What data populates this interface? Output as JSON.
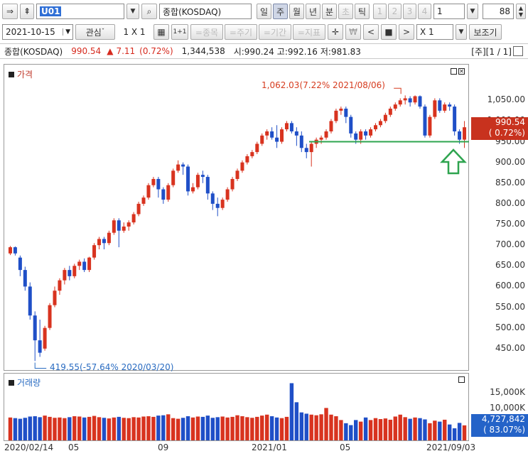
{
  "toolbar1": {
    "code": "U01",
    "index_name": "종합(KOSDAQ)",
    "periods": [
      "일",
      "주",
      "월",
      "년",
      "분",
      "초",
      "틱"
    ],
    "active_period": "주",
    "counts": [
      "1",
      "2",
      "3",
      "4"
    ],
    "count_value": "1",
    "zoom_value": "88"
  },
  "toolbar2": {
    "date": "2021-10-15",
    "watch_label": "관심",
    "layout_label": "1 X 1",
    "one_label": "1+1",
    "tabs": [
      "=종목",
      "=주기",
      "=기간",
      "=지표"
    ],
    "won_symbol": "₩",
    "multiplier": "X 1",
    "aux_label": "보조기"
  },
  "info": {
    "name": "종합(KOSDAQ)",
    "price": "990.54",
    "change_arrow": "▲",
    "change": "7.11",
    "change_pct": "(0.72%)",
    "volume": "1,344,538",
    "open": "시:990.24",
    "high": "고:992.16",
    "low": "저:981.83",
    "period_tag": "[주][1 / 1]"
  },
  "chart_data": [
    {
      "type": "candlestick",
      "title": "가격",
      "x_labels": [
        "2020/02/14",
        "05",
        "09",
        "2021/01",
        "05",
        "2021/09/03"
      ],
      "y_ticks": [
        450,
        500,
        550,
        600,
        650,
        700,
        750,
        800,
        850,
        900,
        950,
        1000,
        1050
      ],
      "ylim": [
        405,
        1090
      ],
      "annotations": {
        "high": "1,062.03(7.22% 2021/08/06)",
        "low": "419.55(-57.64% 2020/03/20)",
        "support_level": 950
      },
      "current_price": "990.54",
      "current_pct": "( 0.72%)",
      "candles": [
        {
          "o": 680,
          "c": 695,
          "h": 698,
          "l": 676
        },
        {
          "o": 695,
          "c": 680,
          "h": 697,
          "l": 675
        },
        {
          "o": 670,
          "c": 640,
          "h": 675,
          "l": 625
        },
        {
          "o": 640,
          "c": 600,
          "h": 648,
          "l": 590
        },
        {
          "o": 600,
          "c": 530,
          "h": 610,
          "l": 520
        },
        {
          "o": 530,
          "c": 470,
          "h": 540,
          "l": 420
        },
        {
          "o": 470,
          "c": 440,
          "h": 520,
          "l": 430
        },
        {
          "o": 450,
          "c": 500,
          "h": 505,
          "l": 445
        },
        {
          "o": 500,
          "c": 555,
          "h": 560,
          "l": 495
        },
        {
          "o": 555,
          "c": 590,
          "h": 600,
          "l": 550
        },
        {
          "o": 590,
          "c": 615,
          "h": 620,
          "l": 580
        },
        {
          "o": 615,
          "c": 640,
          "h": 645,
          "l": 605
        },
        {
          "o": 640,
          "c": 625,
          "h": 650,
          "l": 615
        },
        {
          "o": 625,
          "c": 650,
          "h": 655,
          "l": 620
        },
        {
          "o": 650,
          "c": 660,
          "h": 665,
          "l": 640
        },
        {
          "o": 660,
          "c": 640,
          "h": 668,
          "l": 635
        },
        {
          "o": 640,
          "c": 670,
          "h": 672,
          "l": 635
        },
        {
          "o": 670,
          "c": 700,
          "h": 705,
          "l": 665
        },
        {
          "o": 700,
          "c": 715,
          "h": 720,
          "l": 690
        },
        {
          "o": 715,
          "c": 705,
          "h": 720,
          "l": 690
        },
        {
          "o": 705,
          "c": 730,
          "h": 735,
          "l": 700
        },
        {
          "o": 730,
          "c": 760,
          "h": 765,
          "l": 725
        },
        {
          "o": 760,
          "c": 735,
          "h": 765,
          "l": 695
        },
        {
          "o": 735,
          "c": 745,
          "h": 755,
          "l": 730
        },
        {
          "o": 745,
          "c": 755,
          "h": 760,
          "l": 735
        },
        {
          "o": 755,
          "c": 775,
          "h": 780,
          "l": 750
        },
        {
          "o": 775,
          "c": 800,
          "h": 805,
          "l": 770
        },
        {
          "o": 800,
          "c": 815,
          "h": 820,
          "l": 795
        },
        {
          "o": 815,
          "c": 845,
          "h": 850,
          "l": 810
        },
        {
          "o": 845,
          "c": 860,
          "h": 865,
          "l": 840
        },
        {
          "o": 860,
          "c": 835,
          "h": 865,
          "l": 815
        },
        {
          "o": 835,
          "c": 810,
          "h": 840,
          "l": 800
        },
        {
          "o": 810,
          "c": 845,
          "h": 850,
          "l": 805
        },
        {
          "o": 845,
          "c": 880,
          "h": 885,
          "l": 840
        },
        {
          "o": 880,
          "c": 895,
          "h": 905,
          "l": 875
        },
        {
          "o": 895,
          "c": 890,
          "h": 900,
          "l": 870
        },
        {
          "o": 890,
          "c": 830,
          "h": 895,
          "l": 820
        },
        {
          "o": 830,
          "c": 840,
          "h": 850,
          "l": 825
        },
        {
          "o": 840,
          "c": 870,
          "h": 875,
          "l": 835
        },
        {
          "o": 870,
          "c": 865,
          "h": 880,
          "l": 850
        },
        {
          "o": 865,
          "c": 825,
          "h": 870,
          "l": 810
        },
        {
          "o": 825,
          "c": 800,
          "h": 830,
          "l": 785
        },
        {
          "o": 800,
          "c": 790,
          "h": 815,
          "l": 770
        },
        {
          "o": 790,
          "c": 810,
          "h": 815,
          "l": 785
        },
        {
          "o": 810,
          "c": 835,
          "h": 840,
          "l": 805
        },
        {
          "o": 835,
          "c": 860,
          "h": 865,
          "l": 830
        },
        {
          "o": 860,
          "c": 880,
          "h": 885,
          "l": 855
        },
        {
          "o": 880,
          "c": 900,
          "h": 905,
          "l": 875
        },
        {
          "o": 900,
          "c": 915,
          "h": 920,
          "l": 895
        },
        {
          "o": 915,
          "c": 925,
          "h": 930,
          "l": 910
        },
        {
          "o": 925,
          "c": 945,
          "h": 950,
          "l": 920
        },
        {
          "o": 945,
          "c": 965,
          "h": 970,
          "l": 940
        },
        {
          "o": 965,
          "c": 975,
          "h": 980,
          "l": 955
        },
        {
          "o": 975,
          "c": 960,
          "h": 985,
          "l": 955
        },
        {
          "o": 960,
          "c": 950,
          "h": 990,
          "l": 935
        },
        {
          "o": 950,
          "c": 980,
          "h": 985,
          "l": 945
        },
        {
          "o": 980,
          "c": 995,
          "h": 1000,
          "l": 975
        },
        {
          "o": 995,
          "c": 975,
          "h": 1000,
          "l": 970
        },
        {
          "o": 975,
          "c": 965,
          "h": 985,
          "l": 940
        },
        {
          "o": 965,
          "c": 935,
          "h": 975,
          "l": 925
        },
        {
          "o": 935,
          "c": 925,
          "h": 945,
          "l": 910
        },
        {
          "o": 925,
          "c": 945,
          "h": 950,
          "l": 890
        },
        {
          "o": 945,
          "c": 955,
          "h": 960,
          "l": 935
        },
        {
          "o": 955,
          "c": 960,
          "h": 965,
          "l": 945
        },
        {
          "o": 960,
          "c": 975,
          "h": 980,
          "l": 955
        },
        {
          "o": 975,
          "c": 1000,
          "h": 1005,
          "l": 970
        },
        {
          "o": 1000,
          "c": 1025,
          "h": 1030,
          "l": 995
        },
        {
          "o": 1025,
          "c": 1030,
          "h": 1035,
          "l": 1015
        },
        {
          "o": 1030,
          "c": 1010,
          "h": 1035,
          "l": 995
        },
        {
          "o": 1010,
          "c": 970,
          "h": 1015,
          "l": 960
        },
        {
          "o": 970,
          "c": 955,
          "h": 975,
          "l": 945
        },
        {
          "o": 955,
          "c": 975,
          "h": 980,
          "l": 945
        },
        {
          "o": 975,
          "c": 965,
          "h": 980,
          "l": 955
        },
        {
          "o": 965,
          "c": 980,
          "h": 985,
          "l": 960
        },
        {
          "o": 980,
          "c": 990,
          "h": 995,
          "l": 975
        },
        {
          "o": 990,
          "c": 1000,
          "h": 1005,
          "l": 985
        },
        {
          "o": 1000,
          "c": 1015,
          "h": 1020,
          "l": 995
        },
        {
          "o": 1015,
          "c": 1030,
          "h": 1035,
          "l": 1010
        },
        {
          "o": 1030,
          "c": 1040,
          "h": 1045,
          "l": 1025
        },
        {
          "o": 1040,
          "c": 1050,
          "h": 1055,
          "l": 1035
        },
        {
          "o": 1050,
          "c": 1055,
          "h": 1062,
          "l": 1040
        },
        {
          "o": 1055,
          "c": 1045,
          "h": 1060,
          "l": 1035
        },
        {
          "o": 1045,
          "c": 1060,
          "h": 1062,
          "l": 1040
        },
        {
          "o": 1060,
          "c": 1035,
          "h": 1062,
          "l": 1030
        },
        {
          "o": 1035,
          "c": 965,
          "h": 1040,
          "l": 960
        },
        {
          "o": 965,
          "c": 1010,
          "h": 1015,
          "l": 960
        },
        {
          "o": 1010,
          "c": 1050,
          "h": 1055,
          "l": 1005
        },
        {
          "o": 1050,
          "c": 1025,
          "h": 1055,
          "l": 1020
        },
        {
          "o": 1025,
          "c": 1040,
          "h": 1045,
          "l": 1020
        },
        {
          "o": 1040,
          "c": 1035,
          "h": 1045,
          "l": 1025
        },
        {
          "o": 1035,
          "c": 975,
          "h": 1040,
          "l": 965
        },
        {
          "o": 975,
          "c": 955,
          "h": 980,
          "l": 945
        },
        {
          "o": 955,
          "c": 985,
          "h": 1000,
          "l": 935
        }
      ]
    },
    {
      "type": "bar",
      "title": "거래량",
      "y_ticks": [
        "15,000K",
        "10,000K"
      ],
      "current_volume": "4,727,842",
      "current_pct": "( 83.07%)",
      "vmax": 19000,
      "values": [
        7200,
        7000,
        6800,
        7100,
        7500,
        7600,
        7300,
        7800,
        7400,
        7100,
        7200,
        7000,
        7300,
        7600,
        7500,
        7200,
        7400,
        7700,
        7300,
        7100,
        6900,
        7200,
        7400,
        7100,
        7000,
        7300,
        7200,
        7500,
        7600,
        7400,
        7800,
        7900,
        8200,
        7000,
        6800,
        7100,
        7600,
        7200,
        7500,
        7400,
        7800,
        7100,
        7300,
        7500,
        7200,
        7400,
        7900,
        7600,
        7300,
        7100,
        7400,
        7800,
        8100,
        7600,
        7200,
        7000,
        7400,
        18000,
        12000,
        8800,
        8400,
        8100,
        7900,
        8200,
        10200,
        8100,
        7600,
        6400,
        5400,
        4800,
        6400,
        5900,
        7200,
        6400,
        7000,
        6700,
        6900,
        6500,
        7500,
        8100,
        7300,
        6800,
        7200,
        7000,
        6600,
        5400,
        6200,
        5900,
        6500,
        5000,
        3800,
        5500,
        4727
      ]
    }
  ]
}
